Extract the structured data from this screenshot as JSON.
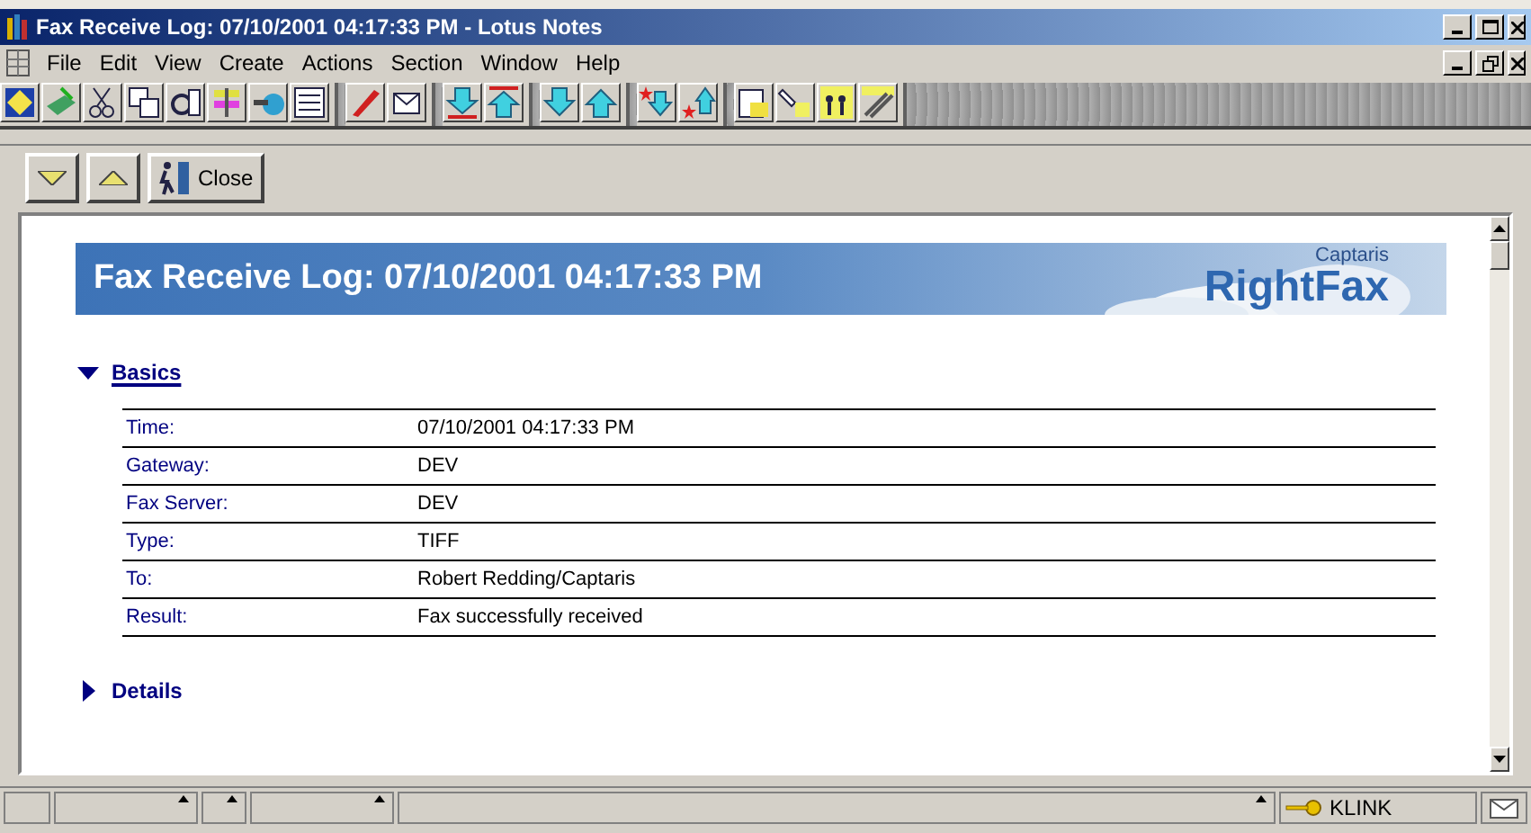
{
  "window": {
    "title": "Fax Receive Log: 07/10/2001 04:17:33 PM - Lotus Notes"
  },
  "menu": [
    "File",
    "Edit",
    "View",
    "Create",
    "Actions",
    "Section",
    "Window",
    "Help"
  ],
  "action_bar": [
    {
      "kind": "next"
    },
    {
      "kind": "previous"
    },
    {
      "kind": "close",
      "label": "Close"
    }
  ],
  "banner": {
    "title": "Fax Receive Log: 07/10/2001 04:17:33 PM",
    "brand_small": "Captaris",
    "brand_large": "RightFax"
  },
  "sections": [
    {
      "title": "Basics",
      "expanded": true,
      "rows": [
        {
          "label": "Time:",
          "value": "07/10/2001 04:17:33 PM"
        },
        {
          "label": "Gateway:",
          "value": "DEV"
        },
        {
          "label": "Fax Server:",
          "value": "DEV"
        },
        {
          "label": "Type:",
          "value": "TIFF"
        },
        {
          "label": "To:",
          "value": "Robert Redding/Captaris"
        },
        {
          "label": "Result:",
          "value": "Fax successfully received"
        }
      ]
    },
    {
      "title": "Details",
      "expanded": false
    }
  ],
  "status_bar": {
    "user": "KLINK"
  }
}
